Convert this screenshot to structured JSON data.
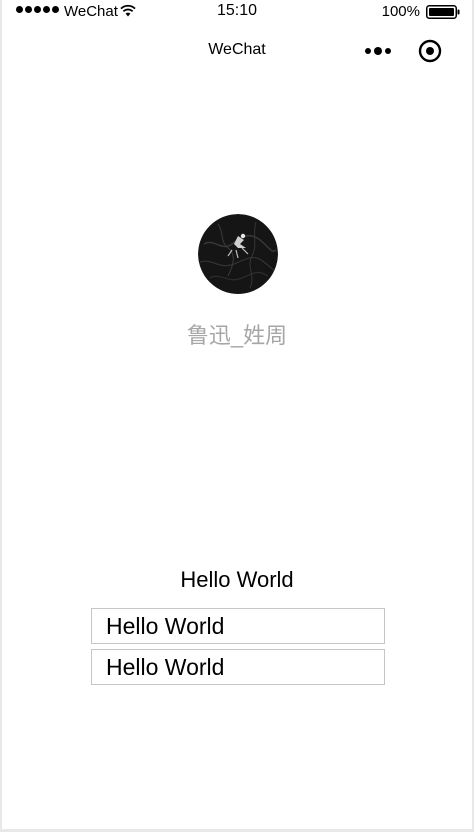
{
  "status_bar": {
    "carrier": "WeChat",
    "time": "15:10",
    "battery": "100%"
  },
  "nav_bar": {
    "title": "WeChat"
  },
  "user": {
    "nickname": "鲁迅_姓周"
  },
  "content": {
    "motto": "Hello World",
    "inputs": [
      {
        "value": "Hello World"
      },
      {
        "value": "Hello World"
      }
    ]
  },
  "icons": {
    "signal": "signal-dots-icon",
    "wifi": "wifi-icon",
    "battery": "battery-icon",
    "more": "more-dots-icon",
    "close": "target-close-icon"
  },
  "colors": {
    "nickname": "#a6a6a6",
    "input_border": "#c6c6c6"
  }
}
